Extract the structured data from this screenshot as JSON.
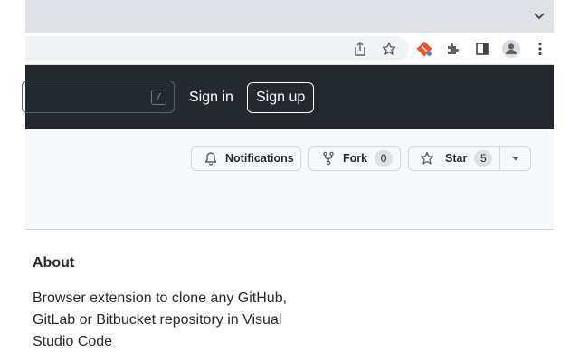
{
  "header": {
    "search_hint_key": "/",
    "sign_in_label": "Sign in",
    "sign_up_label": "Sign up"
  },
  "repo_actions": {
    "notifications_label": "Notifications",
    "fork_label": "Fork",
    "fork_count": "0",
    "star_label": "Star",
    "star_count": "5"
  },
  "about": {
    "title": "About",
    "description": "Browser extension to clone any GitHub, GitLab or Bitbucket repository in Visual Studio Code"
  },
  "icons": {
    "tab_search": "chevron-down-icon",
    "share": "share-icon",
    "bookmark": "star-outline-icon",
    "extension_git": "git-extension-icon",
    "extensions": "puzzle-icon",
    "side_panel": "side-panel-icon",
    "profile": "profile-avatar-icon",
    "menu": "kebab-menu-icon"
  },
  "colors": {
    "header_bg": "#24292f",
    "strip_bg": "#f6f8fa",
    "git_orange": "#f05133"
  }
}
